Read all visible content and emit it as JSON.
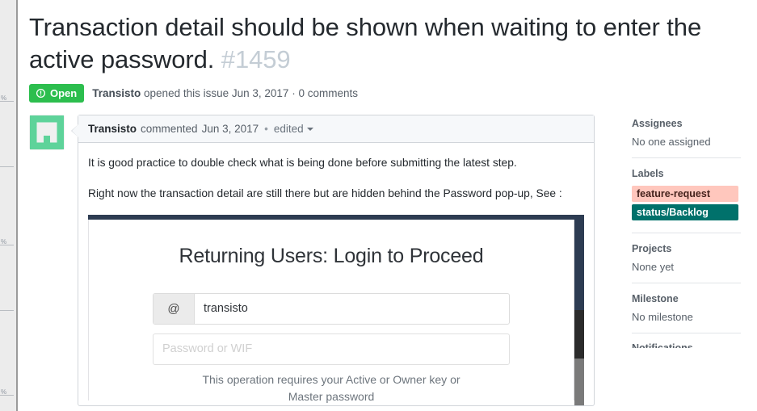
{
  "ruler": {
    "mark": "%",
    "marks_count": 3
  },
  "issue": {
    "title": "Transaction detail should be shown when waiting to enter the active password.",
    "number": "#1459",
    "state_label": "Open",
    "state_icon": "issue-opened-icon",
    "state_color": "#2cbe4e",
    "meta_author": "Transisto",
    "meta_action": "opened this issue",
    "meta_date": "Jun 3, 2017",
    "meta_separator": "·",
    "meta_comments": "0 comments"
  },
  "comment": {
    "avatar_icon": "identicon-avatar",
    "avatar_color": "#5ed39a",
    "author": "Transisto",
    "action": "commented",
    "date": "Jun 3, 2017",
    "separator": "•",
    "edited_label": "edited",
    "edited_caret_icon": "chevron-down-icon",
    "paragraphs": [
      "It is good practice to double check what is being done before submitting the latest step.",
      "Right now the transaction detail are still there but are hidden behind the Password pop-up, See :"
    ]
  },
  "embedded_screenshot": {
    "alt_name": "login-screenshot",
    "title": "Returning Users: Login to Proceed",
    "username_addon": "@",
    "username_value": "transisto",
    "password_placeholder": "Password or WIF",
    "hint_line1": "This operation requires your Active or Owner key or Master",
    "hint_line2": "password",
    "bg_navy": "#2d3c52",
    "bg_dark": "#2b2b2b",
    "bg_gray": "#7a7a7a"
  },
  "sidebar": {
    "assignees": {
      "heading": "Assignees",
      "value": "No one assigned"
    },
    "labels": {
      "heading": "Labels",
      "items": [
        {
          "name": "feature-request",
          "bg": "#ffc7bd",
          "fg": "#45231d"
        },
        {
          "name": "status/Backlog",
          "bg": "#00716b",
          "fg": "#ffffff"
        }
      ]
    },
    "projects": {
      "heading": "Projects",
      "value": "None yet"
    },
    "milestone": {
      "heading": "Milestone",
      "value": "No milestone"
    },
    "cut_off": {
      "heading": "Notifications"
    }
  }
}
